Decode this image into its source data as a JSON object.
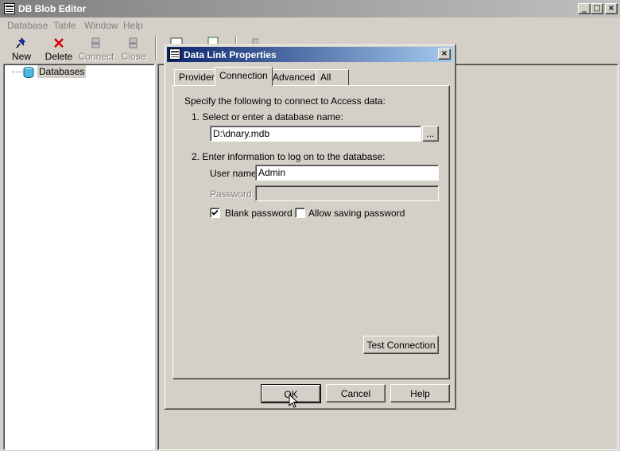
{
  "app": {
    "title": "DB Blob Editor",
    "window_controls": {
      "minimize": "_",
      "maximize": "□",
      "close": "×"
    }
  },
  "menu": [
    "Database",
    "Table",
    "Window",
    "Help"
  ],
  "toolbar": {
    "new_label": "New",
    "delete_label": "Delete",
    "connect_label": "Connect",
    "close_label": "Close"
  },
  "tree": {
    "root_label": "Databases"
  },
  "dialog": {
    "title": "Data Link Properties",
    "close_glyph": "×",
    "tabs": [
      "Provider",
      "Connection",
      "Advanced",
      "All"
    ],
    "active_tab": "Connection",
    "intro": "Specify the following to connect to Access data:",
    "step1_label": "1. Select or enter a database name:",
    "database_name": "D:\\dnary.mdb",
    "browse_label": "...",
    "step2_label": "2. Enter information to log on to the database:",
    "username_label": "User name:",
    "username_value": "Admin",
    "password_label": "Password:",
    "password_value": "",
    "blank_password_label": "Blank password",
    "blank_password_checked": true,
    "allow_saving_label": "Allow saving password",
    "allow_saving_checked": false,
    "test_connection_label": "Test Connection",
    "ok_label": "OK",
    "cancel_label": "Cancel",
    "help_label": "Help"
  },
  "colors": {
    "dialog_title_start": "#0a246a",
    "dialog_title_end": "#a6caf0",
    "inactive_title_start": "#808080",
    "face": "#d4d0c8"
  }
}
